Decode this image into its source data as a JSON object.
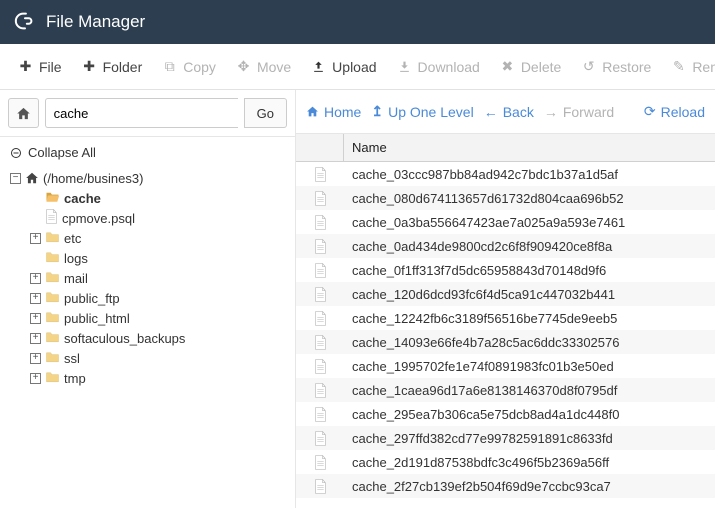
{
  "header": {
    "title": "File Manager"
  },
  "toolbar": {
    "file": "File",
    "folder": "Folder",
    "copy": "Copy",
    "move": "Move",
    "upload": "Upload",
    "download": "Download",
    "delete": "Delete",
    "restore": "Restore",
    "rename": "Rename"
  },
  "pathbar": {
    "value": "cache",
    "go": "Go"
  },
  "collapse": "Collapse All",
  "tree": {
    "root": "(/home/busines3)",
    "items": [
      {
        "label": "cache",
        "bold": true,
        "expander": ""
      },
      {
        "label": "cpmove.psql",
        "expander": "",
        "isFile": true
      },
      {
        "label": "etc",
        "expander": "+"
      },
      {
        "label": "logs",
        "expander": ""
      },
      {
        "label": "mail",
        "expander": "+"
      },
      {
        "label": "public_ftp",
        "expander": "+"
      },
      {
        "label": "public_html",
        "expander": "+"
      },
      {
        "label": "softaculous_backups",
        "expander": "+"
      },
      {
        "label": "ssl",
        "expander": "+"
      },
      {
        "label": "tmp",
        "expander": "+"
      }
    ]
  },
  "nav": {
    "home": "Home",
    "up": "Up One Level",
    "back": "Back",
    "forward": "Forward",
    "reload": "Reload"
  },
  "grid": {
    "name_header": "Name",
    "files": [
      "cache_03ccc987bb84ad942c7bdc1b37a1d5af",
      "cache_080d674113657d61732d804caa696b52",
      "cache_0a3ba556647423ae7a025a9a593e7461",
      "cache_0ad434de9800cd2c6f8f909420ce8f8a",
      "cache_0f1ff313f7d5dc65958843d70148d9f6",
      "cache_120d6dcd93fc6f4d5ca91c447032b441",
      "cache_12242fb6c3189f56516be7745de9eeb5",
      "cache_14093e66fe4b7a28c5ac6ddc33302576",
      "cache_1995702fe1e74f0891983fc01b3e50ed",
      "cache_1caea96d17a6e8138146370d8f0795df",
      "cache_295ea7b306ca5e75dcb8ad4a1dc448f0",
      "cache_297ffd382cd77e99782591891c8633fd",
      "cache_2d191d87538bdfc3c496f5b2369a56ff",
      "cache_2f27cb139ef2b504f69d9e7ccbc93ca7"
    ]
  }
}
